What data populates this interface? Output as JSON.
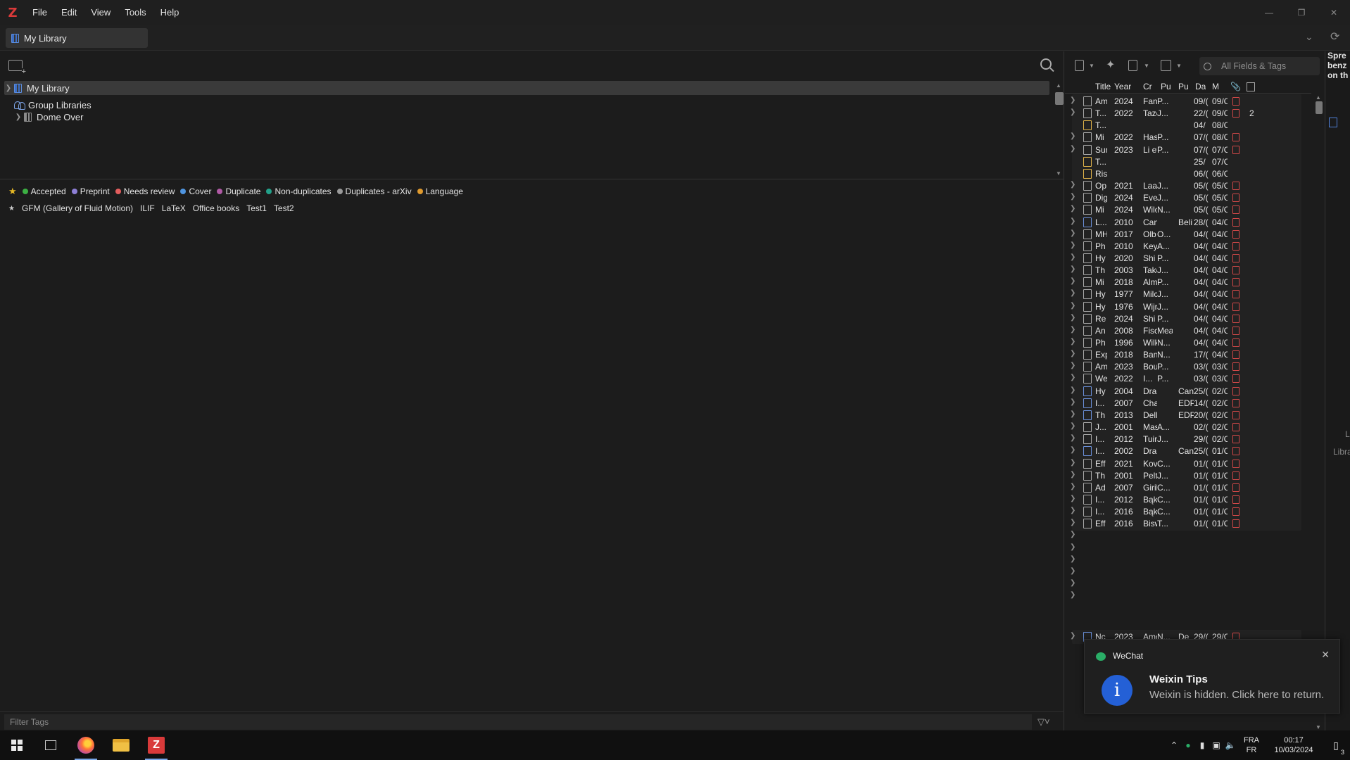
{
  "menubar": {
    "logo": "Z",
    "menus": [
      "File",
      "Edit",
      "View",
      "Tools",
      "Help"
    ]
  },
  "tabbar": {
    "library_tab": "My Library"
  },
  "collections": {
    "my_library": "My Library",
    "group_libraries": "Group Libraries",
    "group": "Dome Over"
  },
  "tags": {
    "colored": [
      {
        "label": "Accepted",
        "color": "#3cb043"
      },
      {
        "label": "Preprint",
        "color": "#8e7fd6"
      },
      {
        "label": "Needs review",
        "color": "#e35d5d"
      },
      {
        "label": "Cover",
        "color": "#4f95e0"
      },
      {
        "label": "Duplicate",
        "color": "#b15aa6"
      },
      {
        "label": "Non-duplicates",
        "color": "#22a18a"
      },
      {
        "label": "Duplicates - arXiv",
        "color": "#9a9a9a"
      },
      {
        "label": "Language",
        "color": "#e09a2e"
      }
    ],
    "star_emoji": "★",
    "plain": [
      "GFM (Gallery of Fluid Motion)",
      "ILIF",
      "LaTeX",
      "Office books",
      "Test1",
      "Test2"
    ],
    "filter_placeholder": "Filter Tags"
  },
  "items_toolbar": {
    "search_placeholder": "All Fields & Tags"
  },
  "items_columns": [
    "Title",
    "Year",
    "Cr",
    "Pu",
    "Pu",
    "Da",
    "M"
  ],
  "items": [
    {
      "t": "Am",
      "y": "2024",
      "cr": "Fan",
      "pu": "P...",
      "pu2": "",
      "da": "09/(",
      "mo": "09/C",
      "type": "doc",
      "att": true,
      "notes": ""
    },
    {
      "t": "T...",
      "y": "2022",
      "cr": "Taze",
      "pu": "J...",
      "pu2": "",
      "da": "22/(",
      "mo": "09/C",
      "type": "doc",
      "att": true,
      "notes": "2"
    },
    {
      "t": "T...",
      "y": "",
      "cr": "",
      "pu": "",
      "pu2": "",
      "da": "04/",
      "mo": "08/C",
      "type": "note",
      "att": false,
      "notes": ""
    },
    {
      "t": "Mi",
      "y": "2022",
      "cr": "Has",
      "pu": "P...",
      "pu2": "",
      "da": "07/(",
      "mo": "08/C",
      "type": "doc",
      "att": true,
      "notes": ""
    },
    {
      "t": "Sur",
      "y": "2023",
      "cr": "Li et",
      "pu": "P...",
      "pu2": "",
      "da": "07/(",
      "mo": "07/C",
      "type": "doc",
      "att": true,
      "notes": ""
    },
    {
      "t": "T...",
      "y": "",
      "cr": "",
      "pu": "",
      "pu2": "",
      "da": "25/",
      "mo": "07/C",
      "type": "note",
      "att": false,
      "notes": ""
    },
    {
      "t": "Ris",
      "y": "",
      "cr": "",
      "pu": "",
      "pu2": "",
      "da": "06/(",
      "mo": "06/C",
      "type": "note",
      "att": false,
      "notes": ""
    },
    {
      "t": "Op",
      "y": "2021",
      "cr": "Laal",
      "pu": "J...",
      "pu2": "",
      "da": "05/(",
      "mo": "05/C",
      "type": "doc",
      "att": true,
      "notes": ""
    },
    {
      "t": "Dig",
      "y": "2024",
      "cr": "Eve",
      "pu": "J...",
      "pu2": "",
      "da": "05/(",
      "mo": "05/C",
      "type": "doc",
      "att": true,
      "notes": ""
    },
    {
      "t": "Mi",
      "y": "2024",
      "cr": "Wilc",
      "pu": "N...",
      "pu2": "",
      "da": "05/(",
      "mo": "05/C",
      "type": "doc",
      "att": true,
      "notes": ""
    },
    {
      "t": "L...",
      "y": "2010",
      "cr": "Can",
      "pu": "",
      "pu2": "Beli",
      "da": "28/(",
      "mo": "04/C",
      "type": "book",
      "att": true,
      "notes": ""
    },
    {
      "t": "MH",
      "y": "2017",
      "cr": "Olb",
      "pu": "O...",
      "pu2": "",
      "da": "04/(",
      "mo": "04/C",
      "type": "doc",
      "att": true,
      "notes": ""
    },
    {
      "t": "Ph",
      "y": "2010",
      "cr": "Key",
      "pu": "A...",
      "pu2": "",
      "da": "04/(",
      "mo": "04/C",
      "type": "doc",
      "att": true,
      "notes": ""
    },
    {
      "t": "Hy",
      "y": "2020",
      "cr": "Shi",
      "pu": "P...",
      "pu2": "",
      "da": "04/(",
      "mo": "04/C",
      "type": "doc",
      "att": true,
      "notes": ""
    },
    {
      "t": "Th",
      "y": "2003",
      "cr": "Take",
      "pu": "J...",
      "pu2": "",
      "da": "04/(",
      "mo": "04/C",
      "type": "doc",
      "att": true,
      "notes": ""
    },
    {
      "t": "Mi",
      "y": "2018",
      "cr": "Alm",
      "pu": "P...",
      "pu2": "",
      "da": "04/(",
      "mo": "04/C",
      "type": "doc",
      "att": true,
      "notes": ""
    },
    {
      "t": "Hy",
      "y": "1977",
      "cr": "Milc",
      "pu": "J...",
      "pu2": "",
      "da": "04/(",
      "mo": "04/C",
      "type": "doc",
      "att": true,
      "notes": ""
    },
    {
      "t": "Hy",
      "y": "1976",
      "cr": "Wijr",
      "pu": "J...",
      "pu2": "",
      "da": "04/(",
      "mo": "04/C",
      "type": "doc",
      "att": true,
      "notes": ""
    },
    {
      "t": "Re",
      "y": "2024",
      "cr": "Shi",
      "pu": "P...",
      "pu2": "",
      "da": "04/(",
      "mo": "04/C",
      "type": "doc",
      "att": true,
      "notes": ""
    },
    {
      "t": "An",
      "y": "2008",
      "cr": "Fisc",
      "pu": "Mea:",
      "pu2": "",
      "da": "04/(",
      "mo": "04/C",
      "type": "doc",
      "att": true,
      "notes": ""
    },
    {
      "t": "Ph",
      "y": "1996",
      "cr": "Wilk",
      "pu": "N...",
      "pu2": "",
      "da": "04/(",
      "mo": "04/C",
      "type": "doc",
      "att": true,
      "notes": ""
    },
    {
      "t": "Exp",
      "y": "2018",
      "cr": "Ban",
      "pu": "N...",
      "pu2": "",
      "da": "17/(",
      "mo": "04/C",
      "type": "doc",
      "att": true,
      "notes": ""
    },
    {
      "t": "Am",
      "y": "2023",
      "cr": "Bou",
      "pu": "P...",
      "pu2": "",
      "da": "03/(",
      "mo": "03/C",
      "type": "doc",
      "att": true,
      "notes": ""
    },
    {
      "t": "We",
      "y": "2022",
      "cr": "I...",
      "pu": "P...",
      "pu2": "",
      "da": "03/(",
      "mo": "03/C",
      "type": "doc",
      "att": true,
      "notes": ""
    },
    {
      "t": "Hy",
      "y": "2004",
      "cr": "Dra",
      "pu": "",
      "pu2": "Can",
      "da": "25/(",
      "mo": "02/C",
      "type": "book",
      "att": true,
      "notes": ""
    },
    {
      "t": "I...",
      "y": "2007",
      "cr": "Cha",
      "pu": "",
      "pu2": "EDP",
      "da": "14/(",
      "mo": "02/C",
      "type": "book",
      "att": true,
      "notes": ""
    },
    {
      "t": "Th",
      "y": "2013",
      "cr": "Dell",
      "pu": "",
      "pu2": "EDP",
      "da": "20/(",
      "mo": "02/C",
      "type": "book",
      "att": true,
      "notes": ""
    },
    {
      "t": "J...",
      "y": "2001",
      "cr": "Mas",
      "pu": "A...",
      "pu2": "",
      "da": "02/(",
      "mo": "02/C",
      "type": "doc",
      "att": true,
      "notes": ""
    },
    {
      "t": "I...",
      "y": "2012",
      "cr": "Tuir",
      "pu": "J...",
      "pu2": "",
      "da": "29/(",
      "mo": "02/C",
      "type": "doc",
      "att": true,
      "notes": ""
    },
    {
      "t": "I...",
      "y": "2002",
      "cr": "Dra",
      "pu": "",
      "pu2": "Can",
      "da": "25/(",
      "mo": "01/C",
      "type": "book",
      "att": true,
      "notes": ""
    },
    {
      "t": "Eff",
      "y": "2021",
      "cr": "Kov",
      "pu": "C...",
      "pu2": "",
      "da": "01/(",
      "mo": "01/C",
      "type": "doc",
      "att": true,
      "notes": ""
    },
    {
      "t": "Th",
      "y": "2001",
      "cr": "Pelt",
      "pu": "J...",
      "pu2": "",
      "da": "01/(",
      "mo": "01/C",
      "type": "doc",
      "att": true,
      "notes": ""
    },
    {
      "t": "Ad",
      "y": "2007",
      "cr": "Giril",
      "pu": "C...",
      "pu2": "",
      "da": "01/(",
      "mo": "01/C",
      "type": "doc",
      "att": true,
      "notes": ""
    },
    {
      "t": "I...",
      "y": "2012",
      "cr": "Bąk",
      "pu": "C...",
      "pu2": "",
      "da": "01/(",
      "mo": "01/C",
      "type": "doc",
      "att": true,
      "notes": ""
    },
    {
      "t": "I...",
      "y": "2016",
      "cr": "Bąk",
      "pu": "C...",
      "pu2": "",
      "da": "01/(",
      "mo": "01/C",
      "type": "doc",
      "att": true,
      "notes": ""
    },
    {
      "t": "Eff",
      "y": "2016",
      "cr": "Bisw",
      "pu": "T...",
      "pu2": "",
      "da": "01/(",
      "mo": "01/C",
      "type": "doc",
      "att": true,
      "notes": ""
    }
  ],
  "last_item": {
    "t": "Nc",
    "y": "2023",
    "cr": "Amc",
    "pu": "N...",
    "pu2": "De",
    "da": "29/(",
    "mo": "29/C"
  },
  "item_pane_fragments": [
    "Spre",
    "benz",
    "on th",
    "L",
    "Libra"
  ],
  "wechat": {
    "app": "WeChat",
    "title": "Weixin Tips",
    "body": "Weixin is hidden. Click here to return."
  },
  "taskbar": {
    "lang_top": "FRA",
    "lang_bottom": "FR",
    "time": "00:17",
    "date": "10/03/2024",
    "notif_count": "3"
  }
}
